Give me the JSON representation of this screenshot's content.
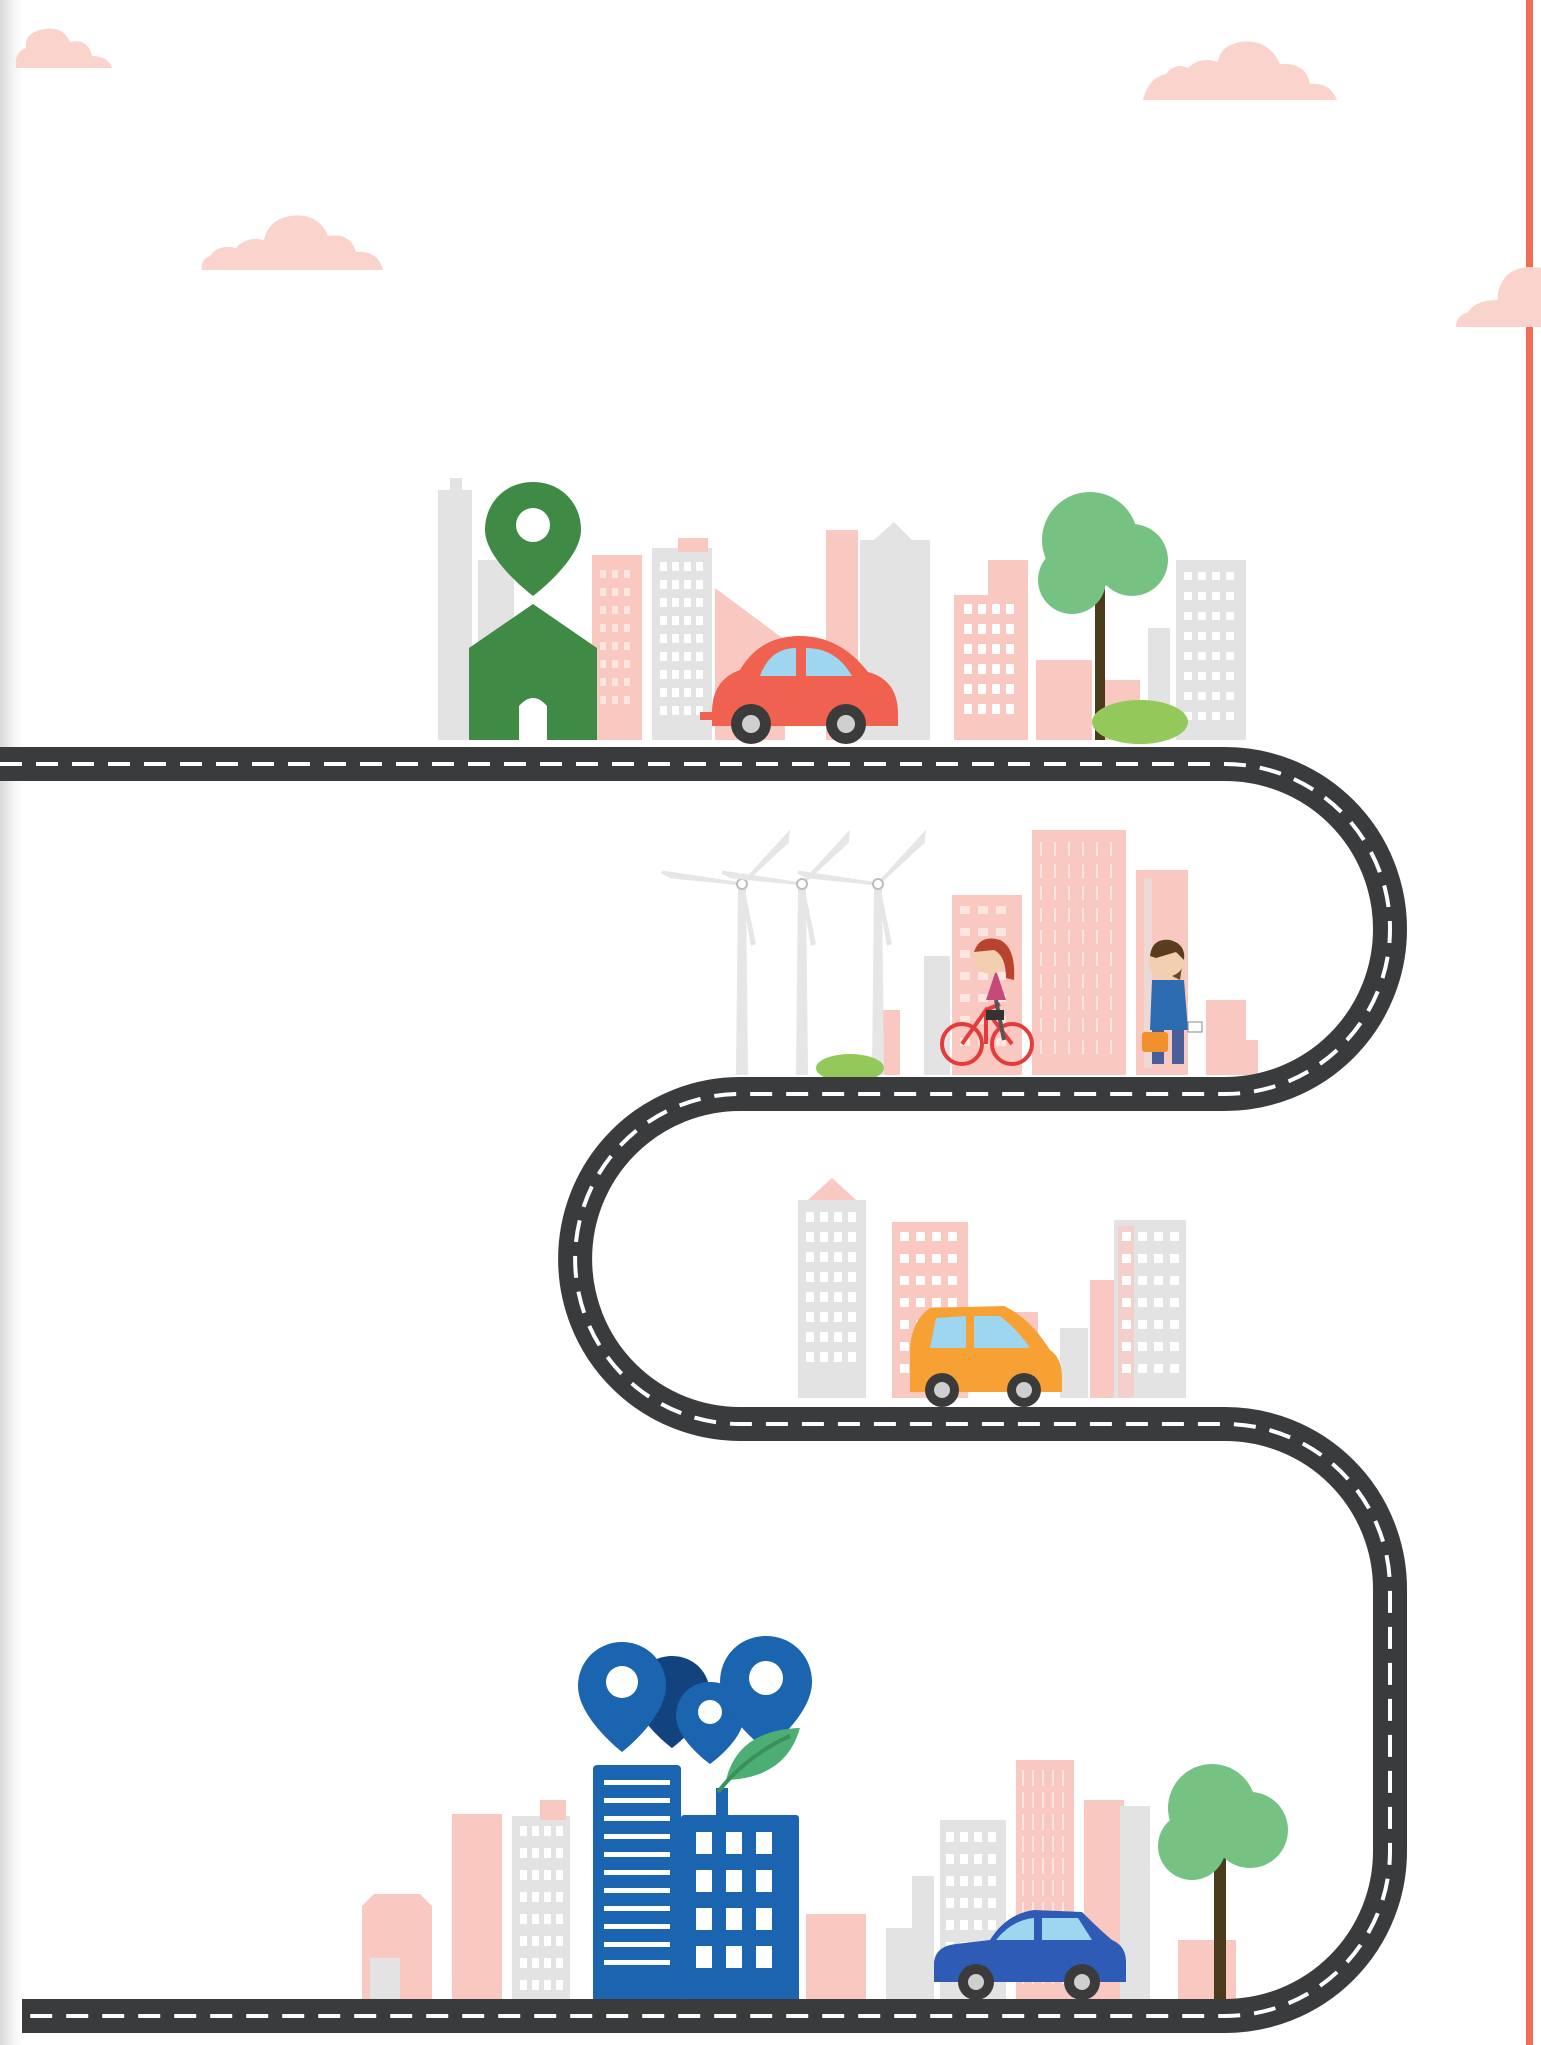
{
  "colors": {
    "road": "#3a3b3d",
    "road_dash": "#ffffff",
    "accent_edge": "#f26b55",
    "cloud": "#fbd3cd",
    "building_pink": "#f9c8c0",
    "building_grey": "#e3e3e3",
    "home_pin": "#3f8b45",
    "destination_blue": "#1a64b0",
    "destination_blue_dark": "#12437f",
    "car_red": "#f06150",
    "car_orange": "#f7a135",
    "car_blue": "#2d5bb5",
    "tree_green": "#75c283",
    "tree_trunk": "#4a3b1c",
    "bush_green": "#93c95b",
    "leaf_green": "#4cae73"
  },
  "scene": {
    "top_stop": {
      "pin_icon": "location-pin-icon",
      "building_icon": "home-icon",
      "vehicle_icon": "car-icon",
      "tree_icon": "tree-icon"
    },
    "second_stop": {
      "icons": [
        "wind-turbine-icon",
        "cyclist-icon",
        "pedestrian-icon"
      ]
    },
    "third_stop": {
      "vehicle_icon": "car-icon"
    },
    "bottom_stop": {
      "icons": [
        "location-pin-icon",
        "office-building-icon",
        "leaf-icon",
        "car-icon",
        "tree-icon"
      ]
    }
  }
}
